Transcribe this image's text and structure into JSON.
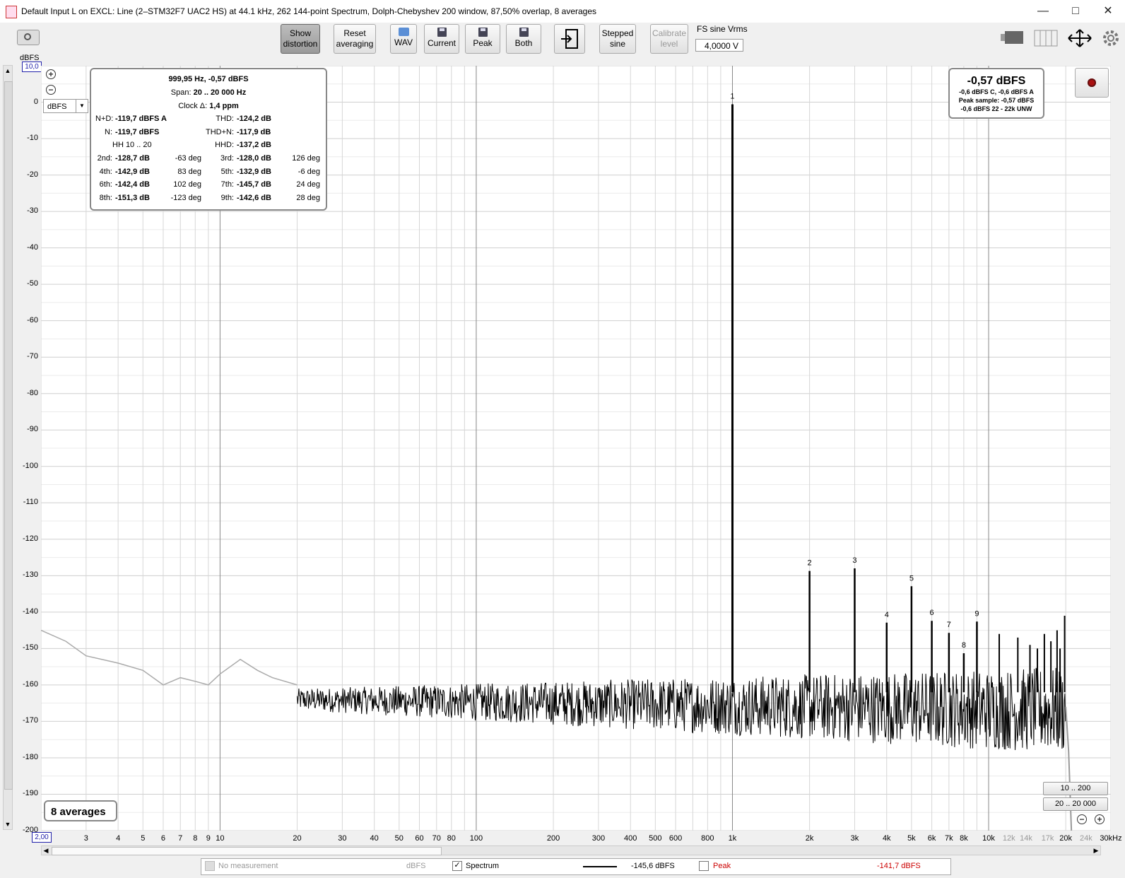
{
  "window": {
    "title": "Default Input L on EXCL: Line (2–STM32F7 UAC2 HS) at 44.1 kHz, 262 144-point Spectrum, Dolph-Chebyshev 200 window, 87,50% overlap, 8 averages",
    "minimize": "—",
    "maximize": "□",
    "close": "✕"
  },
  "toolbar": {
    "show_distortion": [
      "Show",
      "distortion"
    ],
    "reset_averaging": [
      "Reset",
      "averaging"
    ],
    "wav": "WAV",
    "current": "Current",
    "peak": "Peak",
    "both": "Both",
    "stepped_sine": [
      "Stepped",
      "sine"
    ],
    "calibrate_level": [
      "Calibrate",
      "level"
    ],
    "fs_label": "FS sine Vrms",
    "fs_value": "4,0000 V"
  },
  "plot": {
    "y_unit": "dBFS",
    "y_top_field": "10,0",
    "x_left_field": "2,00",
    "y_selector": "dBFS"
  },
  "info": {
    "header": "999,95 Hz, -0,57 dBFS",
    "span_label": "Span:",
    "span_value": "20 .. 20 000 Hz",
    "clock_label": "Clock Δ:",
    "clock_value": "1,4 ppm",
    "nd_label": "N+D:",
    "nd_value": "-119,7 dBFS A",
    "thd_label": "THD:",
    "thd_value": "-124,2 dB",
    "n_label": "N:",
    "n_value": "-119,7 dBFS",
    "thdn_label": "THD+N:",
    "thdn_value": "-117,9 dB",
    "hh_label": "HH 10 .. 20",
    "hhd_label": "HHD:",
    "hhd_value": "-137,2 dB",
    "harmonics": [
      {
        "label": "2nd:",
        "value": "-128,7 dB",
        "deg": "-63 deg"
      },
      {
        "label": "3rd:",
        "value": "-128,0 dB",
        "deg": "126 deg"
      },
      {
        "label": "4th:",
        "value": "-142,9 dB",
        "deg": "83 deg"
      },
      {
        "label": "5th:",
        "value": "-132,9 dB",
        "deg": "-6 deg"
      },
      {
        "label": "6th:",
        "value": "-142,4 dB",
        "deg": "102 deg"
      },
      {
        "label": "7th:",
        "value": "-145,7 dB",
        "deg": "24 deg"
      },
      {
        "label": "8th:",
        "value": "-151,3 dB",
        "deg": "-123 deg"
      },
      {
        "label": "9th:",
        "value": "-142,6 dB",
        "deg": "28 deg"
      }
    ]
  },
  "level": {
    "main": "-0,57 dBFS",
    "line1": "-0,6 dBFS C, -0,6 dBFS A",
    "line2": "Peak sample: -0,57 dBFS",
    "line3": "-0,6 dBFS 22 - 22k UNW"
  },
  "averages_label": "8 averages",
  "range_buttons": [
    "10 .. 200",
    "20 .. 20 000"
  ],
  "legend": {
    "no_measurement": "No measurement",
    "unit1": "dBFS",
    "spectrum": "Spectrum",
    "spectrum_value": "-145,6 dBFS",
    "peak": "Peak",
    "peak_value": "-141,7 dBFS",
    "peak_color": "#cc0000"
  },
  "chart_data": {
    "type": "line",
    "title": "",
    "xlabel": "",
    "ylabel": "dBFS",
    "x_scale": "log",
    "xlim": [
      2,
      30000
    ],
    "ylim": [
      -200,
      10
    ],
    "grid": true,
    "y_ticks": [
      "0",
      "-10",
      "-20",
      "-30",
      "-40",
      "-50",
      "-60",
      "-70",
      "-80",
      "-90",
      "-100",
      "-110",
      "-120",
      "-130",
      "-140",
      "-150",
      "-160",
      "-170",
      "-180",
      "-190",
      "-200"
    ],
    "x_ticks": [
      {
        "v": 3,
        "t": "3"
      },
      {
        "v": 4,
        "t": "4"
      },
      {
        "v": 5,
        "t": "5"
      },
      {
        "v": 6,
        "t": "6"
      },
      {
        "v": 7,
        "t": "7"
      },
      {
        "v": 8,
        "t": "8"
      },
      {
        "v": 9,
        "t": "9"
      },
      {
        "v": 10,
        "t": "10"
      },
      {
        "v": 20,
        "t": "20"
      },
      {
        "v": 30,
        "t": "30"
      },
      {
        "v": 40,
        "t": "40"
      },
      {
        "v": 50,
        "t": "50"
      },
      {
        "v": 60,
        "t": "60"
      },
      {
        "v": 70,
        "t": "70"
      },
      {
        "v": 80,
        "t": "80"
      },
      {
        "v": 100,
        "t": "100"
      },
      {
        "v": 200,
        "t": "200"
      },
      {
        "v": 300,
        "t": "300"
      },
      {
        "v": 400,
        "t": "400"
      },
      {
        "v": 500,
        "t": "500"
      },
      {
        "v": 600,
        "t": "600"
      },
      {
        "v": 800,
        "t": "800"
      },
      {
        "v": 1000,
        "t": "1k"
      },
      {
        "v": 2000,
        "t": "2k"
      },
      {
        "v": 3000,
        "t": "3k"
      },
      {
        "v": 4000,
        "t": "4k"
      },
      {
        "v": 5000,
        "t": "5k"
      },
      {
        "v": 6000,
        "t": "6k"
      },
      {
        "v": 7000,
        "t": "7k"
      },
      {
        "v": 8000,
        "t": "8k"
      },
      {
        "v": 10000,
        "t": "10k"
      },
      {
        "v": 12000,
        "t": "12k",
        "gray": true
      },
      {
        "v": 14000,
        "t": "14k",
        "gray": true
      },
      {
        "v": 17000,
        "t": "17k",
        "gray": true
      },
      {
        "v": 20000,
        "t": "20k"
      },
      {
        "v": 24000,
        "t": "24k",
        "gray": true
      },
      {
        "v": 30000,
        "t": "30kHz"
      }
    ],
    "peaks": [
      {
        "label": "1",
        "x": 1000,
        "y": -0.57
      },
      {
        "label": "2",
        "x": 2000,
        "y": -128.7
      },
      {
        "label": "3",
        "x": 3000,
        "y": -128.0
      },
      {
        "label": "4",
        "x": 4000,
        "y": -142.9
      },
      {
        "label": "5",
        "x": 5000,
        "y": -132.9
      },
      {
        "label": "6",
        "x": 6000,
        "y": -142.4
      },
      {
        "label": "7",
        "x": 7000,
        "y": -145.7
      },
      {
        "label": "8",
        "x": 8000,
        "y": -151.3
      },
      {
        "label": "9",
        "x": 9000,
        "y": -142.6
      }
    ],
    "extra_spurs": [
      {
        "x": 11000,
        "y": -146
      },
      {
        "x": 13000,
        "y": -147
      },
      {
        "x": 14500,
        "y": -149
      },
      {
        "x": 15500,
        "y": -150
      },
      {
        "x": 16500,
        "y": -146
      },
      {
        "x": 17500,
        "y": -148
      },
      {
        "x": 18500,
        "y": -145
      },
      {
        "x": 19000,
        "y": -150
      },
      {
        "x": 19800,
        "y": -141
      }
    ],
    "noise_floor_db": -166,
    "low_freq_gray": [
      {
        "x": 2.0,
        "y": -145
      },
      {
        "x": 2.5,
        "y": -148
      },
      {
        "x": 3,
        "y": -152
      },
      {
        "x": 4,
        "y": -154
      },
      {
        "x": 5,
        "y": -156
      },
      {
        "x": 6,
        "y": -160
      },
      {
        "x": 7,
        "y": -158
      },
      {
        "x": 8,
        "y": -159
      },
      {
        "x": 9,
        "y": -160
      },
      {
        "x": 10,
        "y": -157
      },
      {
        "x": 12,
        "y": -153
      },
      {
        "x": 14,
        "y": -156
      },
      {
        "x": 16,
        "y": -158
      },
      {
        "x": 20,
        "y": -160
      }
    ]
  }
}
